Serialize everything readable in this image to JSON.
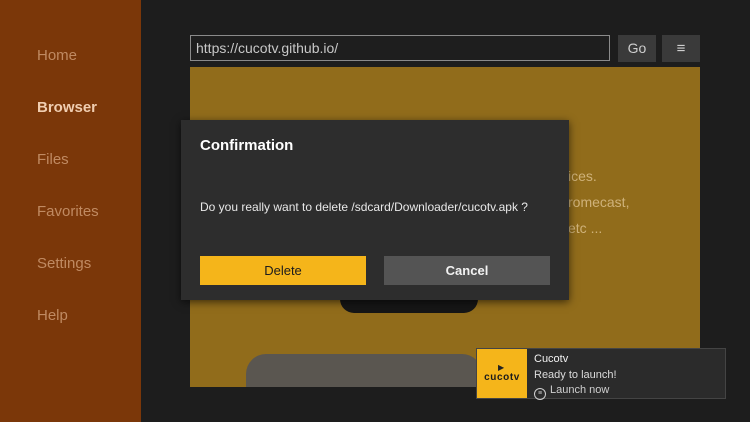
{
  "sidebar": {
    "items": [
      {
        "label": "Home"
      },
      {
        "label": "Browser"
      },
      {
        "label": "Files"
      },
      {
        "label": "Favorites"
      },
      {
        "label": "Settings"
      },
      {
        "label": "Help"
      }
    ],
    "active_index": 1
  },
  "browser": {
    "url": "https://cucotv.github.io/",
    "go_label": "Go",
    "menu_icon": "≡"
  },
  "webpage": {
    "partial_lines": [
      "ices.",
      "romecast,",
      "etc ..."
    ]
  },
  "dialog": {
    "title": "Confirmation",
    "message": "Do you really want to delete /sdcard/Downloader/cucotv.apk ?",
    "delete_label": "Delete",
    "cancel_label": "Cancel"
  },
  "toast": {
    "logo_text": "cucotv",
    "app_name": "Cucotv",
    "message": "Ready to launch!",
    "launch_label": "Launch now"
  },
  "colors": {
    "sidebar_bg": "#7b3709",
    "accent": "#f5b51a",
    "dialog_bg": "#2d2d2d"
  }
}
